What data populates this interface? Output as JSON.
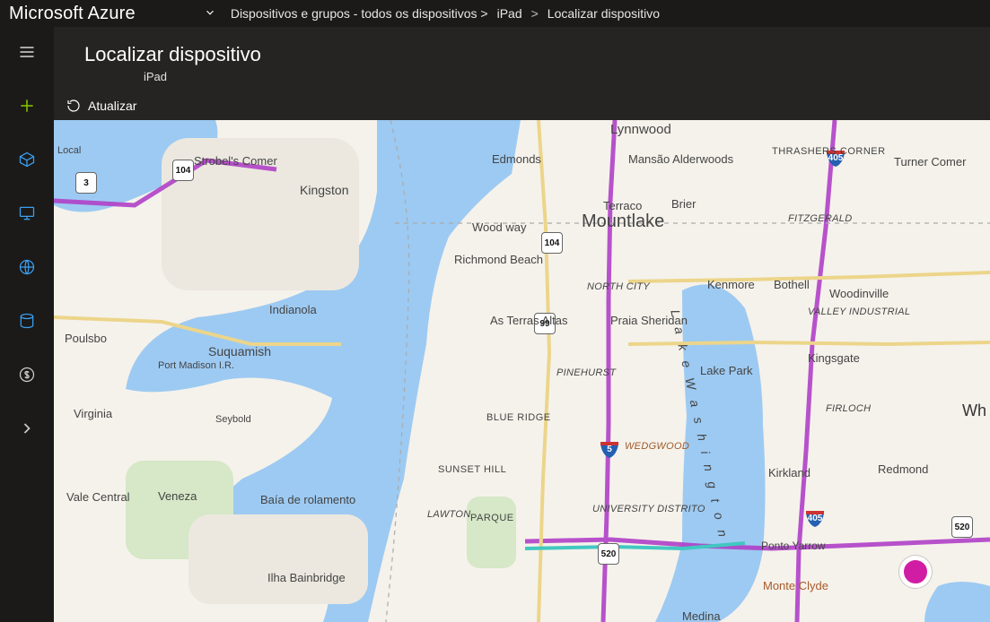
{
  "brand": "Microsoft Azure",
  "breadcrumb": {
    "item1": "Dispositivos e grupos - todos os dispositivos >",
    "item2": "iPad",
    "sep": ">",
    "item3": "Localizar dispositivo"
  },
  "blade": {
    "title": "Localizar dispositivo",
    "subtitle": "iPad"
  },
  "toolbar": {
    "refresh": "Atualizar"
  },
  "map_labels": {
    "local": "Local",
    "strobels": "Strobel's Comer",
    "kingston": "Kingston",
    "indianola": "Indianola",
    "poulsbo": "Poulsbo",
    "suquamish": "Suquamish",
    "portmadison": "Port Madison I.R.",
    "virginia": "Virginia",
    "seybold": "Seybold",
    "veneza": "Veneza",
    "valecentral": "Vale Central",
    "baia": "Baía de rolamento",
    "ilha": "Ilha Bainbridge",
    "edmonds": "Edmonds",
    "woodway": "Wood way",
    "terraco": "Terraco",
    "mountlake": "Mountlake",
    "richmond": "Richmond Beach",
    "asterras": "As Terras Altas",
    "blueridge": "BLUE RIDGE",
    "sunset": "SUNSET HILL",
    "lawton": "LAWTON",
    "parque": "PARQUE",
    "northcity": "NORTH CITY",
    "praia": "Praia Sheridan",
    "pinehurst": "PINEHURST",
    "university": "UNIVERSITY DISTRITO",
    "wedgwood": "WEDGWOOD",
    "brier": "Brier",
    "lynnwood": "Lynnwood",
    "kenmore": "Kenmore",
    "lakepark": "Lake Park",
    "bothell": "Bothell",
    "kirkland": "Kirkland",
    "redmond": "Redmond",
    "woodinville": "Woodinville",
    "kingsgate": "Kingsgate",
    "firloch": "FIRLOCH",
    "valleyind": "VALLEY INDUSTRIAL",
    "mansaoA": "Mansão Alderwoods",
    "thrashers": "THRASHERS CORNER",
    "turner": "Turner Comer",
    "fitzgerald": "FITZGERALD",
    "pontoyarrow": "Ponto Yarrow",
    "monteclyde": "Monte Clyde",
    "medina": "Medina",
    "wh": "Wh",
    "lakewash": "L a k e   W a s h i n g t o n"
  },
  "roads": {
    "r3": "3",
    "r104a": "104",
    "r104b": "104",
    "i5": "5",
    "r99": "99",
    "r520a": "520",
    "r520b": "520",
    "r405a": "405",
    "r405b": "405"
  }
}
